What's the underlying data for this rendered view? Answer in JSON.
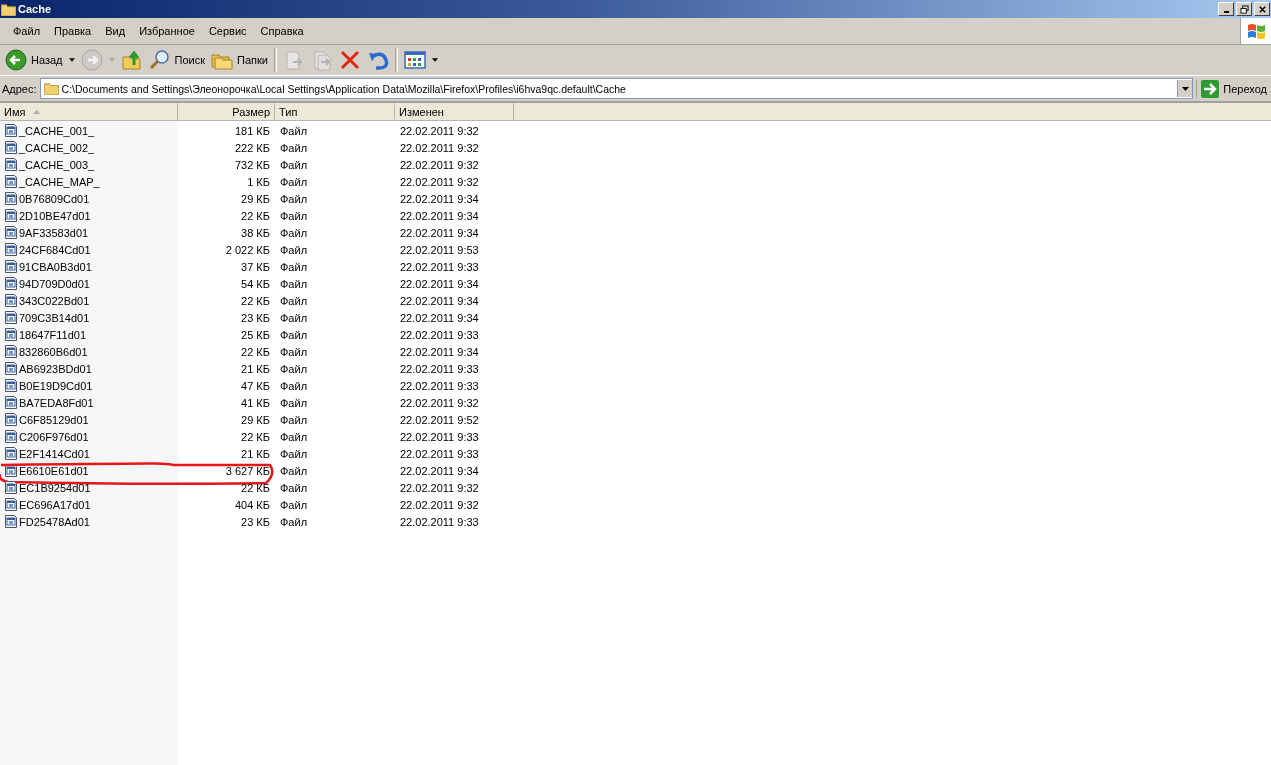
{
  "window": {
    "title": "Cache"
  },
  "menu": [
    "Файл",
    "Правка",
    "Вид",
    "Избранное",
    "Сервис",
    "Справка"
  ],
  "toolbar": [
    {
      "kind": "back",
      "label": "Назад",
      "disabled": false
    },
    {
      "kind": "forward",
      "disabled": true
    },
    {
      "kind": "up",
      "disabled": false
    },
    {
      "kind": "search",
      "label": "Поиск",
      "disabled": false
    },
    {
      "kind": "folders",
      "label": "Папки",
      "disabled": false
    },
    {
      "kind": "move",
      "disabled": true
    },
    {
      "kind": "copy",
      "disabled": true
    },
    {
      "kind": "delete",
      "disabled": false
    },
    {
      "kind": "undo",
      "disabled": false
    },
    {
      "kind": "views",
      "disabled": false
    }
  ],
  "address": {
    "label": "Адрес:",
    "value": "C:\\Documents and Settings\\Элеонорочка\\Local Settings\\Application Data\\Mozilla\\Firefox\\Profiles\\i6hva9qc.default\\Cache",
    "go": "Переход"
  },
  "table": {
    "columns": [
      {
        "label": "Имя",
        "sorted": true
      },
      {
        "label": "Размер",
        "sorted": false
      },
      {
        "label": "Тип",
        "sorted": false
      },
      {
        "label": "Изменен",
        "sorted": false
      }
    ],
    "rows": [
      {
        "name": "_CACHE_001_",
        "size": "181 КБ",
        "type": "Файл",
        "modified": "22.02.2011 9:32",
        "circled": false
      },
      {
        "name": "_CACHE_002_",
        "size": "222 КБ",
        "type": "Файл",
        "modified": "22.02.2011 9:32",
        "circled": false
      },
      {
        "name": "_CACHE_003_",
        "size": "732 КБ",
        "type": "Файл",
        "modified": "22.02.2011 9:32",
        "circled": false
      },
      {
        "name": "_CACHE_MAP_",
        "size": "1 КБ",
        "type": "Файл",
        "modified": "22.02.2011 9:32",
        "circled": false
      },
      {
        "name": "0B76809Cd01",
        "size": "29 КБ",
        "type": "Файл",
        "modified": "22.02.2011 9:34",
        "circled": false
      },
      {
        "name": "2D10BE47d01",
        "size": "22 КБ",
        "type": "Файл",
        "modified": "22.02.2011 9:34",
        "circled": false
      },
      {
        "name": "9AF33583d01",
        "size": "38 КБ",
        "type": "Файл",
        "modified": "22.02.2011 9:34",
        "circled": false
      },
      {
        "name": "24CF684Cd01",
        "size": "2 022 КБ",
        "type": "Файл",
        "modified": "22.02.2011 9:53",
        "circled": false
      },
      {
        "name": "91CBA0B3d01",
        "size": "37 КБ",
        "type": "Файл",
        "modified": "22.02.2011 9:33",
        "circled": false
      },
      {
        "name": "94D709D0d01",
        "size": "54 КБ",
        "type": "Файл",
        "modified": "22.02.2011 9:34",
        "circled": false
      },
      {
        "name": "343C022Bd01",
        "size": "22 КБ",
        "type": "Файл",
        "modified": "22.02.2011 9:34",
        "circled": false
      },
      {
        "name": "709C3B14d01",
        "size": "23 КБ",
        "type": "Файл",
        "modified": "22.02.2011 9:34",
        "circled": false
      },
      {
        "name": "18647F11d01",
        "size": "25 КБ",
        "type": "Файл",
        "modified": "22.02.2011 9:33",
        "circled": false
      },
      {
        "name": "832860B6d01",
        "size": "22 КБ",
        "type": "Файл",
        "modified": "22.02.2011 9:34",
        "circled": false
      },
      {
        "name": "AB6923BDd01",
        "size": "21 КБ",
        "type": "Файл",
        "modified": "22.02.2011 9:33",
        "circled": false
      },
      {
        "name": "B0E19D9Cd01",
        "size": "47 КБ",
        "type": "Файл",
        "modified": "22.02.2011 9:33",
        "circled": false
      },
      {
        "name": "BA7EDA8Fd01",
        "size": "41 КБ",
        "type": "Файл",
        "modified": "22.02.2011 9:32",
        "circled": false
      },
      {
        "name": "C6F85129d01",
        "size": "29 КБ",
        "type": "Файл",
        "modified": "22.02.2011 9:52",
        "circled": false
      },
      {
        "name": "C206F976d01",
        "size": "22 КБ",
        "type": "Файл",
        "modified": "22.02.2011 9:33",
        "circled": false
      },
      {
        "name": "E2F1414Cd01",
        "size": "21 КБ",
        "type": "Файл",
        "modified": "22.02.2011 9:33",
        "circled": false
      },
      {
        "name": "E6610E61d01",
        "size": "3 627 КБ",
        "type": "Файл",
        "modified": "22.02.2011 9:34",
        "circled": true
      },
      {
        "name": "EC1B9254d01",
        "size": "22 КБ",
        "type": "Файл",
        "modified": "22.02.2011 9:32",
        "circled": false
      },
      {
        "name": "EC696A17d01",
        "size": "404 КБ",
        "type": "Файл",
        "modified": "22.02.2011 9:32",
        "circled": false
      },
      {
        "name": "FD25478Ad01",
        "size": "23 КБ",
        "type": "Файл",
        "modified": "22.02.2011 9:33",
        "circled": false
      }
    ]
  }
}
